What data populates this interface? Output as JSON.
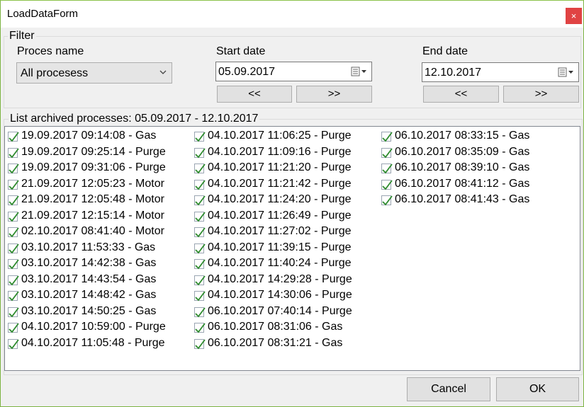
{
  "window": {
    "title": "LoadDataForm",
    "close_glyph": "×"
  },
  "filter": {
    "legend": "Filter",
    "process_label": "Proces name",
    "process_value": "All procesess",
    "start_label": "Start date",
    "start_value": "05.09.2017",
    "end_label": "End date",
    "end_value": "12.10.2017",
    "prev_label": "<<",
    "next_label": ">>"
  },
  "list": {
    "legend": "List archived processes: 05.09.2017 - 12.10.2017",
    "columns": [
      [
        "19.09.2017 09:14:08 - Gas",
        "19.09.2017 09:25:14 - Purge",
        "19.09.2017 09:31:06 - Purge",
        "21.09.2017 12:05:23 - Motor",
        "21.09.2017 12:05:48 - Motor",
        "21.09.2017 12:15:14 - Motor",
        "02.10.2017 08:41:40 - Motor",
        "03.10.2017 11:53:33 - Gas",
        "03.10.2017 14:42:38 - Gas",
        "03.10.2017 14:43:54 - Gas",
        "03.10.2017 14:48:42 - Gas",
        "03.10.2017 14:50:25 - Gas",
        "04.10.2017 10:59:00 - Purge",
        "04.10.2017 11:05:48 - Purge"
      ],
      [
        "04.10.2017 11:06:25 - Purge",
        "04.10.2017 11:09:16 - Purge",
        "04.10.2017 11:21:20 - Purge",
        "04.10.2017 11:21:42 - Purge",
        "04.10.2017 11:24:20 - Purge",
        "04.10.2017 11:26:49 - Purge",
        "04.10.2017 11:27:02 - Purge",
        "04.10.2017 11:39:15 - Purge",
        "04.10.2017 11:40:24 - Purge",
        "04.10.2017 14:29:28 - Purge",
        "04.10.2017 14:30:06 - Purge",
        "06.10.2017 07:40:14 - Purge",
        "06.10.2017 08:31:06 - Gas",
        "06.10.2017 08:31:21 - Gas"
      ],
      [
        "06.10.2017 08:33:15 - Gas",
        "06.10.2017 08:35:09 - Gas",
        "06.10.2017 08:39:10 - Gas",
        "06.10.2017 08:41:12 - Gas",
        "06.10.2017 08:41:43 - Gas"
      ]
    ]
  },
  "buttons": {
    "cancel": "Cancel",
    "ok": "OK"
  }
}
